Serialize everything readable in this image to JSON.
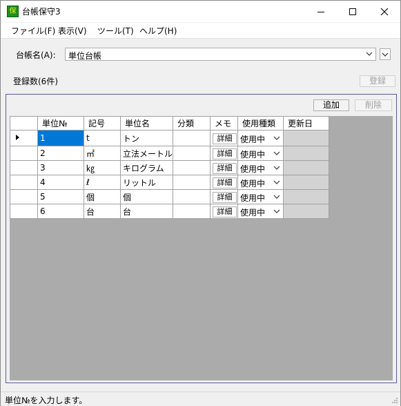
{
  "window": {
    "title": "台帳保守3",
    "icon_glyph": "保"
  },
  "menu": [
    {
      "label": "ファイル(F)"
    },
    {
      "label": "表示(V)"
    },
    {
      "label": "ツール(T)"
    },
    {
      "label": "ヘルプ(H)"
    }
  ],
  "ledger": {
    "label": "台帳名(A):",
    "value": "単位台帳"
  },
  "count_label": "登録数(6件)",
  "buttons": {
    "register": "登録",
    "add": "追加",
    "delete": "削除"
  },
  "grid": {
    "columns": [
      "単位№",
      "記号",
      "単位名",
      "分類",
      "メモ",
      "使用種類",
      "更新日"
    ],
    "detail_label": "詳細",
    "rows": [
      {
        "no": "1",
        "symbol": "t",
        "name": "トン",
        "category": "",
        "usage": "使用中",
        "updated": ""
      },
      {
        "no": "2",
        "symbol": "㎡",
        "name": "立法メートル",
        "category": "",
        "usage": "使用中",
        "updated": ""
      },
      {
        "no": "3",
        "symbol": "㎏",
        "name": "キログラム",
        "category": "",
        "usage": "使用中",
        "updated": ""
      },
      {
        "no": "4",
        "symbol": "ℓ",
        "name": "リットル",
        "category": "",
        "usage": "使用中",
        "updated": ""
      },
      {
        "no": "5",
        "symbol": "個",
        "name": "個",
        "category": "",
        "usage": "使用中",
        "updated": ""
      },
      {
        "no": "6",
        "symbol": "台",
        "name": "台",
        "category": "",
        "usage": "使用中",
        "updated": ""
      }
    ]
  },
  "status_text": "単位№を入力します。",
  "colors": {
    "selection": "#0078d7",
    "grid_background": "#ababab",
    "updated_cell": "#d3d3d3"
  }
}
